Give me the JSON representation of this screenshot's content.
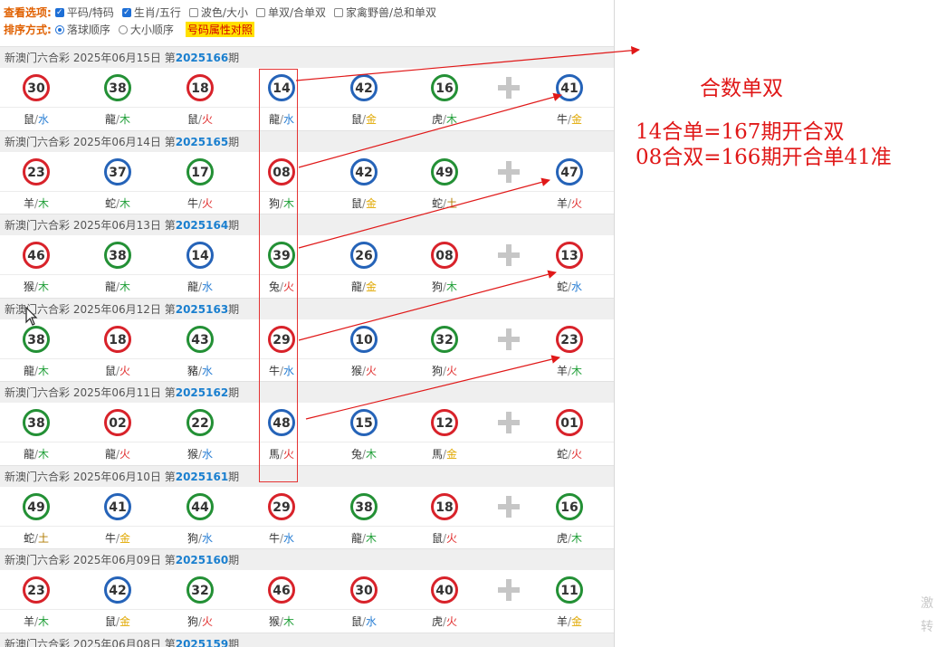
{
  "options": {
    "view_label": "查看选项:",
    "view_items": [
      {
        "label": "平码/特码",
        "checked": true
      },
      {
        "label": "生肖/五行",
        "checked": true
      },
      {
        "label": "波色/大小",
        "checked": false
      },
      {
        "label": "单双/合单双",
        "checked": false
      },
      {
        "label": "家禽野兽/总和单双",
        "checked": false
      }
    ],
    "sort_label": "排序方式:",
    "sort_items": [
      {
        "label": "落球顺序",
        "selected": true
      },
      {
        "label": "大小顺序",
        "selected": false
      }
    ],
    "highlight_link": "号码属性对照"
  },
  "draws": [
    {
      "title": "新澳门六合彩 2025年06月15日 第",
      "period": "2025166",
      "suffix": "期",
      "balls": [
        {
          "num": "30",
          "color": "red",
          "zodiac": "鼠",
          "element": "水",
          "el": "water"
        },
        {
          "num": "38",
          "color": "green",
          "zodiac": "龍",
          "element": "木",
          "el": "wood"
        },
        {
          "num": "18",
          "color": "red",
          "zodiac": "鼠",
          "element": "火",
          "el": "fire"
        },
        {
          "num": "14",
          "color": "blue",
          "zodiac": "龍",
          "element": "水",
          "el": "water"
        },
        {
          "num": "42",
          "color": "blue",
          "zodiac": "鼠",
          "element": "金",
          "el": "metal"
        },
        {
          "num": "16",
          "color": "green",
          "zodiac": "虎",
          "element": "木",
          "el": "wood"
        },
        {
          "num": "41",
          "color": "blue",
          "zodiac": "牛",
          "element": "金",
          "el": "metal"
        }
      ]
    },
    {
      "title": "新澳门六合彩 2025年06月14日 第",
      "period": "2025165",
      "suffix": "期",
      "balls": [
        {
          "num": "23",
          "color": "red",
          "zodiac": "羊",
          "element": "木",
          "el": "wood"
        },
        {
          "num": "37",
          "color": "blue",
          "zodiac": "蛇",
          "element": "木",
          "el": "wood"
        },
        {
          "num": "17",
          "color": "green",
          "zodiac": "牛",
          "element": "火",
          "el": "fire"
        },
        {
          "num": "08",
          "color": "red",
          "zodiac": "狗",
          "element": "木",
          "el": "wood"
        },
        {
          "num": "42",
          "color": "blue",
          "zodiac": "鼠",
          "element": "金",
          "el": "metal"
        },
        {
          "num": "49",
          "color": "green",
          "zodiac": "蛇",
          "element": "土",
          "el": "earth"
        },
        {
          "num": "47",
          "color": "blue",
          "zodiac": "羊",
          "element": "火",
          "el": "fire"
        }
      ]
    },
    {
      "title": "新澳门六合彩 2025年06月13日 第",
      "period": "2025164",
      "suffix": "期",
      "balls": [
        {
          "num": "46",
          "color": "red",
          "zodiac": "猴",
          "element": "木",
          "el": "wood"
        },
        {
          "num": "38",
          "color": "green",
          "zodiac": "龍",
          "element": "木",
          "el": "wood"
        },
        {
          "num": "14",
          "color": "blue",
          "zodiac": "龍",
          "element": "水",
          "el": "water"
        },
        {
          "num": "39",
          "color": "green",
          "zodiac": "兔",
          "element": "火",
          "el": "fire"
        },
        {
          "num": "26",
          "color": "blue",
          "zodiac": "龍",
          "element": "金",
          "el": "metal"
        },
        {
          "num": "08",
          "color": "red",
          "zodiac": "狗",
          "element": "木",
          "el": "wood"
        },
        {
          "num": "13",
          "color": "red",
          "zodiac": "蛇",
          "element": "水",
          "el": "water"
        }
      ]
    },
    {
      "title": "新澳门六合彩 2025年06月12日 第",
      "period": "2025163",
      "suffix": "期",
      "balls": [
        {
          "num": "38",
          "color": "green",
          "zodiac": "龍",
          "element": "木",
          "el": "wood"
        },
        {
          "num": "18",
          "color": "red",
          "zodiac": "鼠",
          "element": "火",
          "el": "fire"
        },
        {
          "num": "43",
          "color": "green",
          "zodiac": "豬",
          "element": "水",
          "el": "water"
        },
        {
          "num": "29",
          "color": "red",
          "zodiac": "牛",
          "element": "水",
          "el": "water"
        },
        {
          "num": "10",
          "color": "blue",
          "zodiac": "猴",
          "element": "火",
          "el": "fire"
        },
        {
          "num": "32",
          "color": "green",
          "zodiac": "狗",
          "element": "火",
          "el": "fire"
        },
        {
          "num": "23",
          "color": "red",
          "zodiac": "羊",
          "element": "木",
          "el": "wood"
        }
      ]
    },
    {
      "title": "新澳门六合彩 2025年06月11日 第",
      "period": "2025162",
      "suffix": "期",
      "balls": [
        {
          "num": "38",
          "color": "green",
          "zodiac": "龍",
          "element": "木",
          "el": "wood"
        },
        {
          "num": "02",
          "color": "red",
          "zodiac": "龍",
          "element": "火",
          "el": "fire"
        },
        {
          "num": "22",
          "color": "green",
          "zodiac": "猴",
          "element": "水",
          "el": "water"
        },
        {
          "num": "48",
          "color": "blue",
          "zodiac": "馬",
          "element": "火",
          "el": "fire"
        },
        {
          "num": "15",
          "color": "blue",
          "zodiac": "兔",
          "element": "木",
          "el": "wood"
        },
        {
          "num": "12",
          "color": "red",
          "zodiac": "馬",
          "element": "金",
          "el": "metal"
        },
        {
          "num": "01",
          "color": "red",
          "zodiac": "蛇",
          "element": "火",
          "el": "fire"
        }
      ]
    },
    {
      "title": "新澳门六合彩 2025年06月10日 第",
      "period": "2025161",
      "suffix": "期",
      "balls": [
        {
          "num": "49",
          "color": "green",
          "zodiac": "蛇",
          "element": "土",
          "el": "earth"
        },
        {
          "num": "41",
          "color": "blue",
          "zodiac": "牛",
          "element": "金",
          "el": "metal"
        },
        {
          "num": "44",
          "color": "green",
          "zodiac": "狗",
          "element": "水",
          "el": "water"
        },
        {
          "num": "29",
          "color": "red",
          "zodiac": "牛",
          "element": "水",
          "el": "water"
        },
        {
          "num": "38",
          "color": "green",
          "zodiac": "龍",
          "element": "木",
          "el": "wood"
        },
        {
          "num": "18",
          "color": "red",
          "zodiac": "鼠",
          "element": "火",
          "el": "fire"
        },
        {
          "num": "16",
          "color": "green",
          "zodiac": "虎",
          "element": "木",
          "el": "wood"
        }
      ]
    },
    {
      "title": "新澳门六合彩 2025年06月09日 第",
      "period": "2025160",
      "suffix": "期",
      "balls": [
        {
          "num": "23",
          "color": "red",
          "zodiac": "羊",
          "element": "木",
          "el": "wood"
        },
        {
          "num": "42",
          "color": "blue",
          "zodiac": "鼠",
          "element": "金",
          "el": "metal"
        },
        {
          "num": "32",
          "color": "green",
          "zodiac": "狗",
          "element": "火",
          "el": "fire"
        },
        {
          "num": "46",
          "color": "red",
          "zodiac": "猴",
          "element": "木",
          "el": "wood"
        },
        {
          "num": "30",
          "color": "red",
          "zodiac": "鼠",
          "element": "水",
          "el": "water"
        },
        {
          "num": "40",
          "color": "red",
          "zodiac": "虎",
          "element": "火",
          "el": "fire"
        },
        {
          "num": "11",
          "color": "green",
          "zodiac": "羊",
          "element": "金",
          "el": "metal"
        }
      ]
    },
    {
      "title": "新澳门六合彩 2025年06月08日 第",
      "period": "2025159",
      "suffix": "期",
      "balls": []
    }
  ],
  "annotation": {
    "heading": "合数单双",
    "line1": "14合单=167期开合双",
    "line2": "08合双=166期开合单41准"
  },
  "watermark": {
    "line1": "激",
    "line2": "转"
  }
}
